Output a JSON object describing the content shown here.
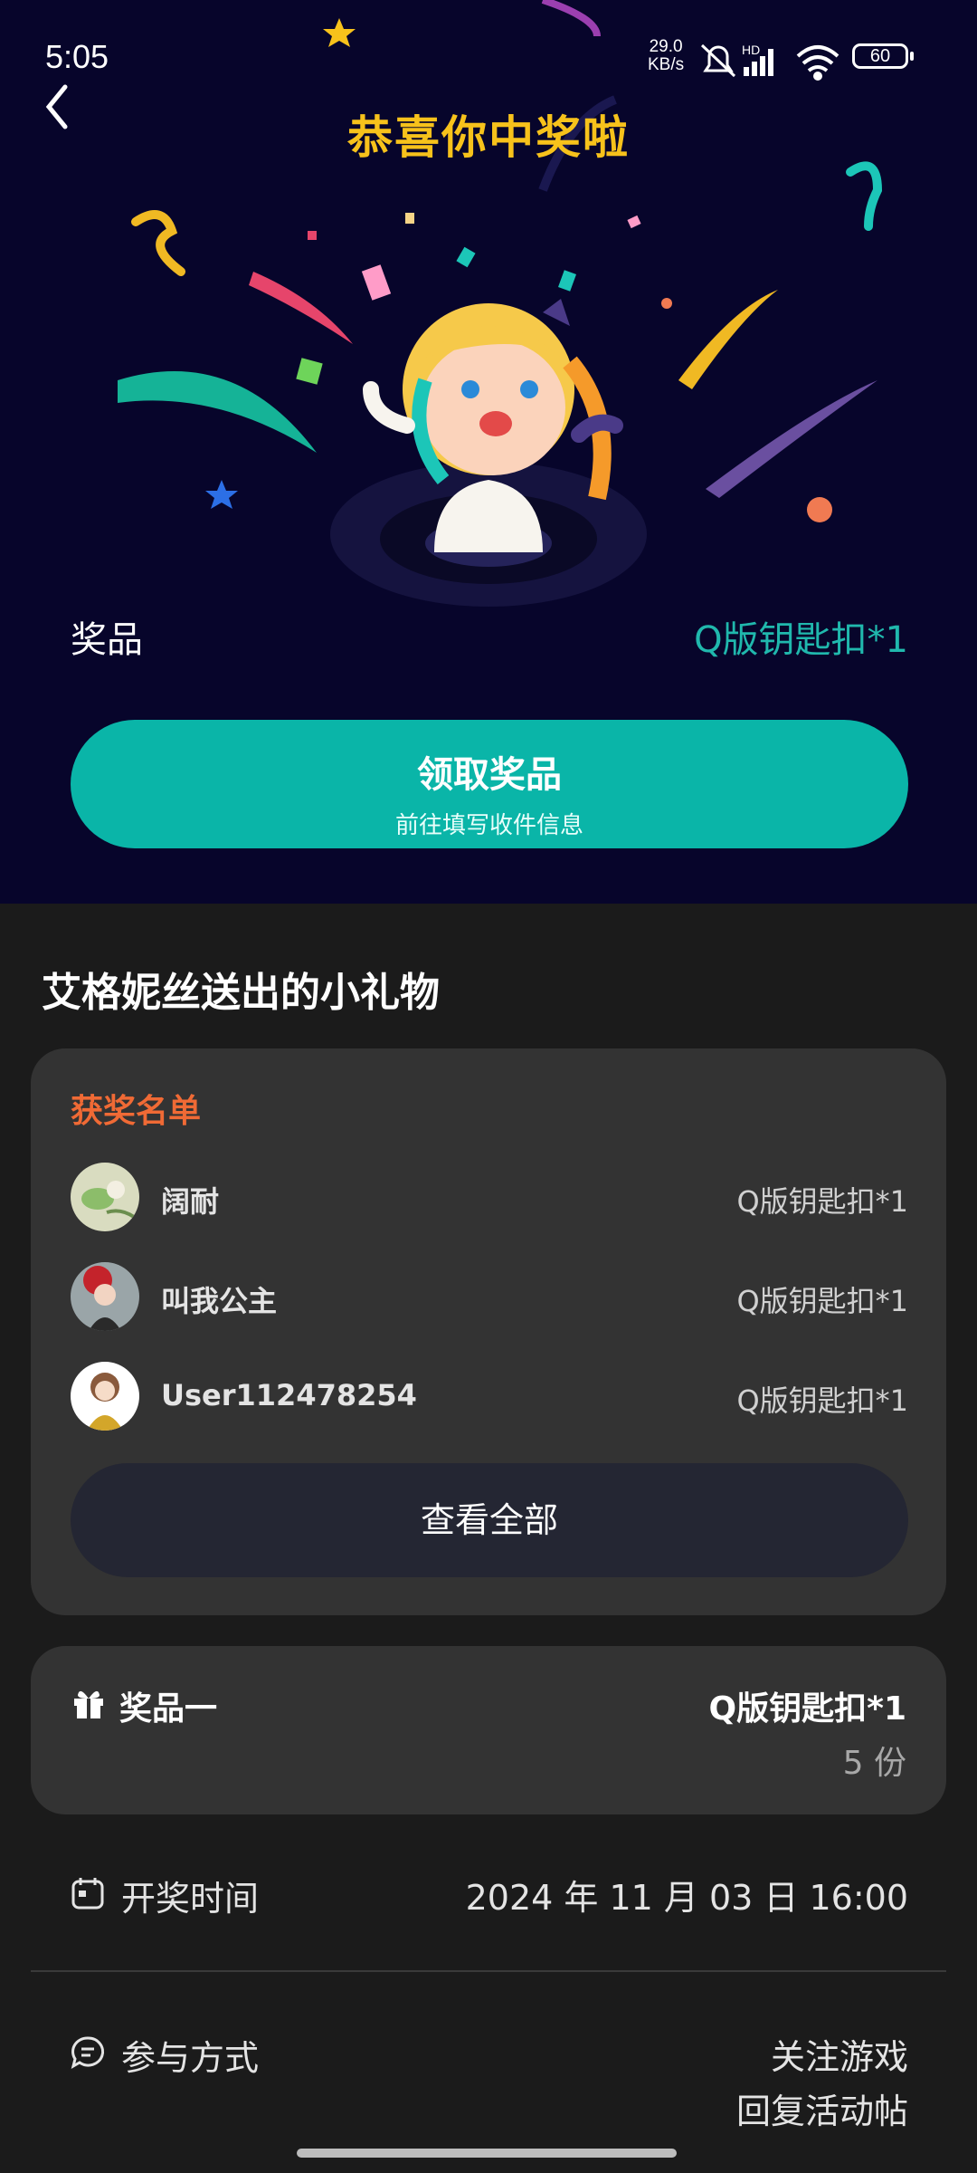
{
  "status_bar": {
    "time": "5:05",
    "speed_value": "29.0",
    "speed_unit": "KB/s",
    "network": "HD",
    "battery": "60"
  },
  "hero": {
    "title": "恭喜你中奖啦",
    "prize_label": "奖品",
    "prize_value": "Q版钥匙扣*1",
    "claim_button": "领取奖品",
    "claim_sub": "前往填写收件信息"
  },
  "section_title": "艾格妮丝送出的小礼物",
  "winners": {
    "heading": "获奖名单",
    "rows": [
      {
        "name": "阔耐",
        "prize": "Q版钥匙扣*1"
      },
      {
        "name": "叫我公主",
        "prize": "Q版钥匙扣*1"
      },
      {
        "name": "User112478254",
        "prize": "Q版钥匙扣*1"
      }
    ],
    "view_all": "查看全部"
  },
  "prize_one": {
    "label": "奖品一",
    "value": "Q版钥匙扣*1",
    "count": "5 份"
  },
  "draw_time": {
    "label": "开奖时间",
    "value": "2024 年 11 月 03 日 16:00"
  },
  "participation": {
    "label": "参与方式",
    "line1": "关注游戏",
    "line2": "回复活动帖"
  },
  "colors": {
    "accent_teal": "#0ab5a8",
    "title_gold": "#f7c21b",
    "winners_orange": "#f06a35"
  }
}
